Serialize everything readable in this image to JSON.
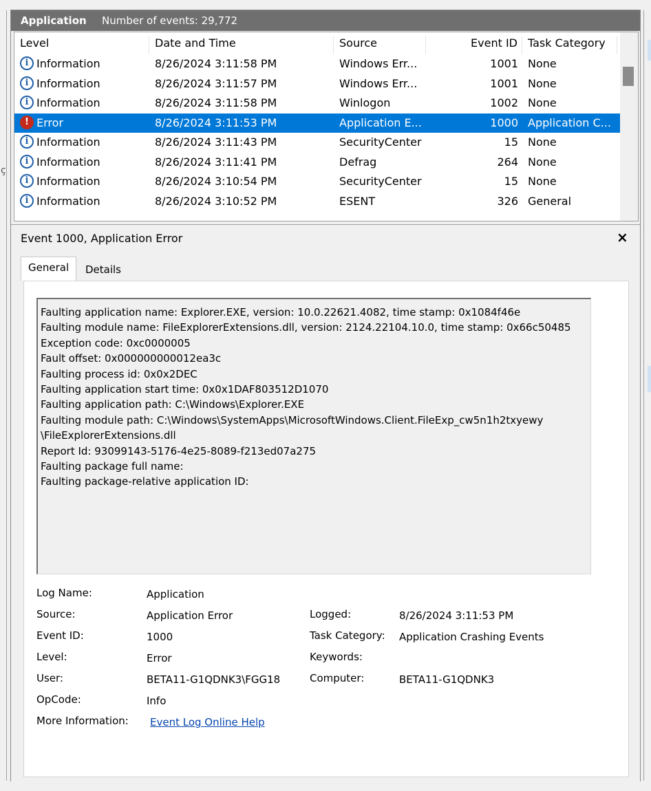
{
  "header": {
    "log_name": "Application",
    "event_count": "Number of events: 29,772"
  },
  "columns": [
    "Level",
    "Date and Time",
    "Source",
    "Event ID",
    "Task Category"
  ],
  "rows": [
    {
      "level": "Information",
      "icon": "info-icon",
      "datetime": "8/26/2024 3:11:58 PM",
      "source": "Windows Err...",
      "event_id": "1001",
      "task": "None"
    },
    {
      "level": "Information",
      "icon": "info-icon",
      "datetime": "8/26/2024 3:11:57 PM",
      "source": "Windows Err...",
      "event_id": "1001",
      "task": "None"
    },
    {
      "level": "Information",
      "icon": "info-icon",
      "datetime": "8/26/2024 3:11:58 PM",
      "source": "Winlogon",
      "event_id": "1002",
      "task": "None"
    },
    {
      "level": "Error",
      "icon": "error-icon",
      "datetime": "8/26/2024 3:11:53 PM",
      "source": "Application E...",
      "event_id": "1000",
      "task": "Application C...",
      "selected": true
    },
    {
      "level": "Information",
      "icon": "info-icon",
      "datetime": "8/26/2024 3:11:43 PM",
      "source": "SecurityCenter",
      "event_id": "15",
      "task": "None"
    },
    {
      "level": "Information",
      "icon": "info-icon",
      "datetime": "8/26/2024 3:11:41 PM",
      "source": "Defrag",
      "event_id": "264",
      "task": "None"
    },
    {
      "level": "Information",
      "icon": "info-icon",
      "datetime": "8/26/2024 3:10:54 PM",
      "source": "SecurityCenter",
      "event_id": "15",
      "task": "None"
    },
    {
      "level": "Information",
      "icon": "info-icon",
      "datetime": "8/26/2024 3:10:52 PM",
      "source": "ESENT",
      "event_id": "326",
      "task": "General"
    }
  ],
  "details": {
    "title": "Event 1000, Application Error",
    "close": "×",
    "tabs": {
      "general": "General",
      "details": "Details"
    },
    "description": [
      "Faulting application name: Explorer.EXE, version: 10.0.22621.4082, time stamp: 0x1084f46e",
      "Faulting module name: FileExplorerExtensions.dll, version: 2124.22104.10.0, time stamp: 0x66c50485",
      "Exception code: 0xc0000005",
      "Fault offset: 0x000000000012ea3c",
      "Faulting process id: 0x0x2DEC",
      "Faulting application start time: 0x0x1DAF803512D1070",
      "Faulting application path: C:\\Windows\\Explorer.EXE",
      "Faulting module path: C:\\Windows\\SystemApps\\MicrosoftWindows.Client.FileExp_cw5n1h2txyewy",
      "\\FileExplorerExtensions.dll",
      "Report Id: 93099143-5176-4e25-8089-f213ed07a275",
      "Faulting package full name:",
      "Faulting package-relative application ID:"
    ],
    "props": {
      "log_name_label": "Log Name:",
      "log_name": "Application",
      "source_label": "Source:",
      "source": "Application Error",
      "logged_label": "Logged:",
      "logged": "8/26/2024 3:11:53 PM",
      "event_id_label": "Event ID:",
      "event_id": "1000",
      "task_category_label": "Task Category:",
      "task_category": "Application Crashing Events",
      "level_label": "Level:",
      "level": "Error",
      "keywords_label": "Keywords:",
      "keywords": "",
      "user_label": "User:",
      "user": "BETA11-G1QDNK3\\FGG18",
      "computer_label": "Computer:",
      "computer": "BETA11-G1QDNK3",
      "opcode_label": "OpCode:",
      "opcode": "Info",
      "more_info_label": "More Information:",
      "more_info_link": "Event Log Online Help"
    }
  },
  "colors": {
    "selection": "#0078d7",
    "header": "#6f6f6f",
    "link": "#0645ad",
    "error": "#c42b1c",
    "info": "#1f5fa8"
  }
}
